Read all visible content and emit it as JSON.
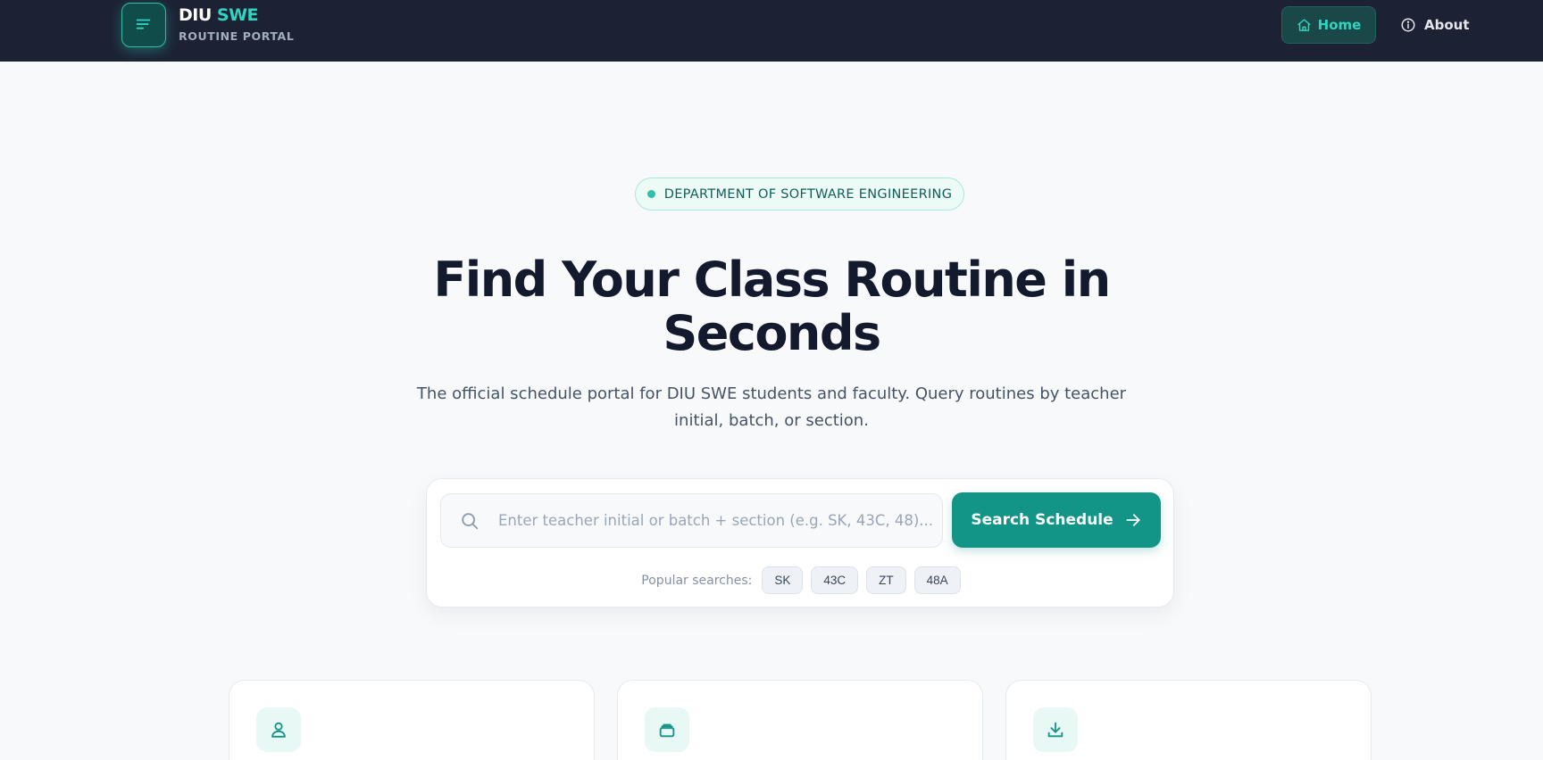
{
  "brand": {
    "title_main": "DIU",
    "title_accent": "SWE",
    "subtitle": "ROUTINE PORTAL"
  },
  "nav": {
    "home_label": "Home",
    "about_label": "About"
  },
  "hero": {
    "badge": "DEPARTMENT OF SOFTWARE ENGINEERING",
    "title_line1": "Find Your Class Routine in",
    "title_line2": "Seconds",
    "description": "The official schedule portal for DIU SWE students and faculty. Query routines by teacher initial, batch, or section."
  },
  "search": {
    "placeholder": "Enter teacher initial or batch + section (e.g. SK, 43C, 48)...",
    "value": "",
    "button_label": "Search Schedule",
    "popular_label": "Popular searches:",
    "popular": [
      "SK",
      "43C",
      "ZT",
      "48A"
    ]
  },
  "features": [
    {
      "icon": "user-icon"
    },
    {
      "icon": "layers-icon"
    },
    {
      "icon": "download-icon"
    }
  ],
  "colors": {
    "nav_bg": "#1c2234",
    "accent": "#2dd4bf",
    "primary_button": "#129486",
    "page_bg": "#f7f9fb"
  }
}
